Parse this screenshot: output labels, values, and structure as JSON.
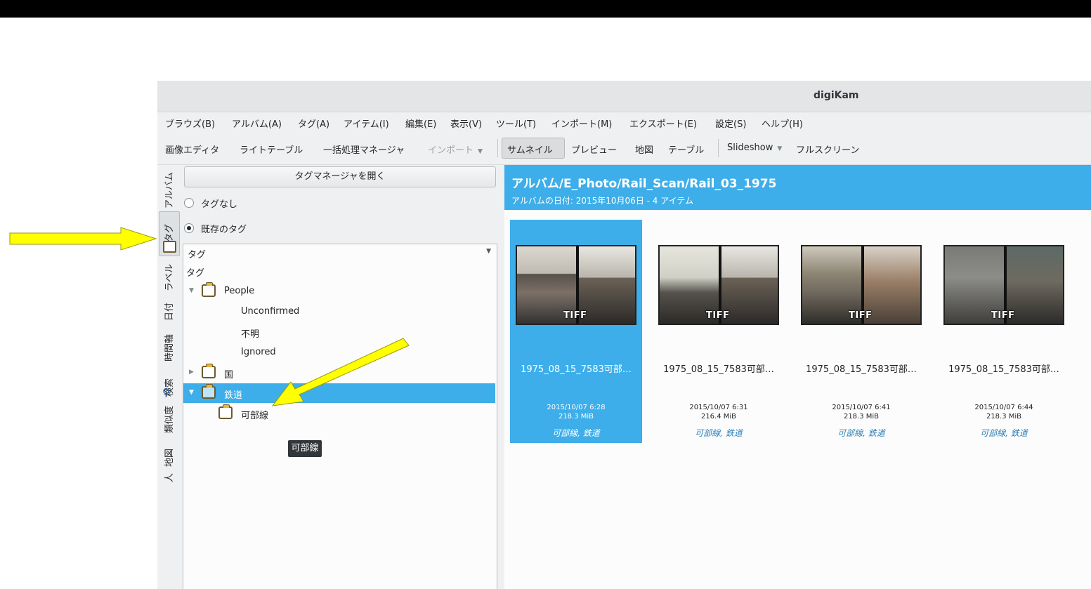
{
  "app": {
    "title": "digiKam"
  },
  "menu": [
    "ブラウズ(B)",
    "アルバム(A)",
    "タグ(A)",
    "アイテム(I)",
    "編集(E)",
    "表示(V)",
    "ツール(T)",
    "インポート(M)",
    "エクスポート(E)",
    "設定(S)",
    "ヘルプ(H)"
  ],
  "toolbar": {
    "image_editor": "画像エディタ",
    "light_table": "ライトテーブル",
    "batch_queue": "一括処理マネージャ",
    "import": "インポート",
    "thumbnails": "サムネイル",
    "preview": "プレビュー",
    "map": "地図",
    "table": "テーブル",
    "slideshow": "Slideshow",
    "fullscreen": "フルスクリーン"
  },
  "sidetabs": {
    "album": "アルバム",
    "tags": "タグ",
    "labels": "ラベル",
    "dates": "日付",
    "timeline": "時間軸",
    "search": "検索",
    "similarity": "類似度",
    "map": "地図",
    "people": "人"
  },
  "tagpanel": {
    "open_manager": "タグマネージャを開く",
    "no_tags": "タグなし",
    "existing_tags": "既存のタグ",
    "combo_value": "タグ",
    "tree": {
      "root": "タグ",
      "people": "People",
      "unconfirmed": "Unconfirmed",
      "unknown": "不明",
      "ignored": "Ignored",
      "country": "国",
      "railway": "鉄道",
      "kabe_line": "可部線"
    },
    "tooltip": "可部線"
  },
  "album": {
    "path": "アルバム/E_Photo/Rail_Scan/Rail_03_1975",
    "subtitle": "アルバムの日付: 2015年10月06日 - 4 アイテム"
  },
  "thumbnails": [
    {
      "name": "1975_08_15_7583可部…",
      "date": "2015/10/07 6:28",
      "size": "218.3 MiB",
      "tags": "可部線, 鉄道",
      "badge": "TIFF"
    },
    {
      "name": "1975_08_15_7583可部…",
      "date": "2015/10/07 6:31",
      "size": "216.4 MiB",
      "tags": "可部線, 鉄道",
      "badge": "TIFF"
    },
    {
      "name": "1975_08_15_7583可部…",
      "date": "2015/10/07 6:41",
      "size": "218.3 MiB",
      "tags": "可部線, 鉄道",
      "badge": "TIFF"
    },
    {
      "name": "1975_08_15_7583可部…",
      "date": "2015/10/07 6:44",
      "size": "218.3 MiB",
      "tags": "可部線, 鉄道",
      "badge": "TIFF"
    }
  ],
  "colors": {
    "accent": "#3daee9",
    "annotation_arrow": "#ffff00"
  }
}
